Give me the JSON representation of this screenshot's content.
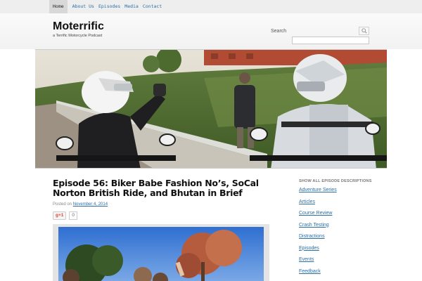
{
  "nav": {
    "items": [
      {
        "label": "Home",
        "active": true
      },
      {
        "label": "About Us"
      },
      {
        "label": "Episodes"
      },
      {
        "label": "Media"
      },
      {
        "label": "Contact"
      }
    ]
  },
  "header": {
    "title": "Moterrific",
    "tagline": "a Terrific Motorcycle Podcast",
    "search_label": "Search",
    "search_placeholder": ""
  },
  "post": {
    "title_line1": "Episode 56: Biker Babe Fashion No’s, SoCal",
    "title_line2": "Norton British Ride, and Bhutan in Brief",
    "posted_on": "Posted on",
    "date": "November 4, 2014",
    "gplus_label": "g+1",
    "gplus_count": "0"
  },
  "sidebar": {
    "heading": "SHOW ALL EPISODE DESCRIPTIONS",
    "items": [
      "Adventure Series",
      "Articles",
      "Course Review",
      "Crash Testing",
      "Distractions",
      "Episodes",
      "Events",
      "Feedback"
    ]
  },
  "colors": {
    "link": "#2a6fa8",
    "topbar": "#eeeeee",
    "gplus": "#d8432e"
  },
  "icons": {
    "search_button": "search-icon"
  }
}
